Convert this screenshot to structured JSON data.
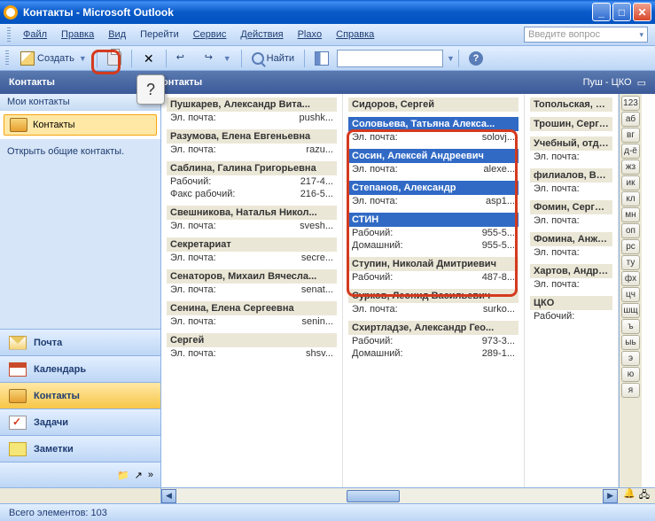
{
  "window": {
    "title": "Контакты - Microsoft Outlook"
  },
  "menu": {
    "file": "Файл",
    "edit": "Правка",
    "view": "Вид",
    "go": "Перейти",
    "service": "Сервис",
    "actions": "Действия",
    "plaxo": "Plaxo",
    "help": "Справка",
    "ask": "Введите вопрос"
  },
  "toolbar": {
    "create": "Создать",
    "find": "Найти",
    "delete_glyph": "✕",
    "help_glyph": "?"
  },
  "header": {
    "left": "Контакты",
    "center": "онтакты",
    "right": "Пуш - ЦКО"
  },
  "sidebar": {
    "section": "Мои контакты",
    "item": "Контакты",
    "link": "Открыть общие контакты.",
    "nav": {
      "mail": "Почта",
      "calendar": "Календарь",
      "contacts": "Контакты",
      "tasks": "Задачи",
      "notes": "Заметки"
    }
  },
  "labels": {
    "email": "Эл. почта:",
    "work": "Рабочий:",
    "workfax": "Факс рабочий:",
    "home": "Домашний:"
  },
  "col1": [
    {
      "name": "Пушкарев, Александр Вита...",
      "rows": [
        [
          "email",
          "pushk..."
        ]
      ]
    },
    {
      "name": "Разумова, Елена Евгеньевна",
      "rows": [
        [
          "email",
          "razu..."
        ]
      ]
    },
    {
      "name": "Саблина, Галина Григорьевна",
      "rows": [
        [
          "work",
          "217-4..."
        ],
        [
          "workfax",
          "216-5..."
        ]
      ]
    },
    {
      "name": "Свешникова, Наталья Никол...",
      "rows": [
        [
          "email",
          "svesh..."
        ]
      ]
    },
    {
      "name": "Секретариат",
      "rows": [
        [
          "email",
          "secre..."
        ]
      ]
    },
    {
      "name": "Сенаторов, Михаил Вячесла...",
      "rows": [
        [
          "email",
          "senat..."
        ]
      ]
    },
    {
      "name": "Сенина, Елена Сергеевна",
      "rows": [
        [
          "email",
          "senin..."
        ]
      ]
    },
    {
      "name": "Сергей",
      "rows": [
        [
          "email",
          "shsv..."
        ]
      ]
    }
  ],
  "col2": [
    {
      "name": "Сидоров, Сергей",
      "sel": false,
      "rows": []
    },
    {
      "name": "Соловьева, Татьяна Алекса...",
      "sel": true,
      "rows": [
        [
          "email",
          "solovj..."
        ]
      ]
    },
    {
      "name": "Сосин, Алексей Андреевич",
      "sel": true,
      "rows": [
        [
          "email",
          "alexe..."
        ]
      ]
    },
    {
      "name": "Степанов, Александр",
      "sel": true,
      "rows": [
        [
          "email",
          "asp1..."
        ]
      ]
    },
    {
      "name": "СТИН",
      "sel": true,
      "rows": [
        [
          "work",
          "955-5..."
        ],
        [
          "home",
          "955-5..."
        ]
      ]
    },
    {
      "name": "Ступин, Николай Дмитриевич",
      "sel": false,
      "rows": [
        [
          "work",
          "487-8..."
        ]
      ]
    },
    {
      "name": "Сурков, Леонид Васильевич",
      "sel": false,
      "rows": [
        [
          "email",
          "surko..."
        ]
      ]
    },
    {
      "name": "Схиртладзе, Александр Гео...",
      "sel": false,
      "rows": [
        [
          "work",
          "973-3..."
        ],
        [
          "home",
          "289-1..."
        ]
      ]
    }
  ],
  "col3": [
    {
      "name": "Топольская, Тат",
      "rows": []
    },
    {
      "name": "Трошин, Сергей К",
      "rows": []
    },
    {
      "name": "Учебный, отдел",
      "rows": [
        [
          "email",
          ""
        ]
      ]
    },
    {
      "name": "филиалов, Все со",
      "rows": [
        [
          "email",
          ""
        ]
      ]
    },
    {
      "name": "Фомин, Сергей Ва",
      "rows": [
        [
          "email",
          ""
        ]
      ]
    },
    {
      "name": "Фомина, Анжели",
      "rows": [
        [
          "email",
          ""
        ]
      ]
    },
    {
      "name": "Хартов, Андрей",
      "rows": [
        [
          "email",
          ""
        ]
      ]
    },
    {
      "name": "ЦКО",
      "rows": [
        [
          "work",
          ""
        ]
      ]
    }
  ],
  "index": [
    "123",
    "аб",
    "вг",
    "д-ё",
    "жз",
    "ик",
    "кл",
    "мн",
    "оп",
    "рс",
    "ту",
    "фх",
    "цч",
    "шщ",
    "ъ",
    "ыь",
    "э",
    "ю",
    "я"
  ],
  "status": {
    "text": "Всего элементов: 103"
  },
  "callout": {
    "q": "?"
  }
}
